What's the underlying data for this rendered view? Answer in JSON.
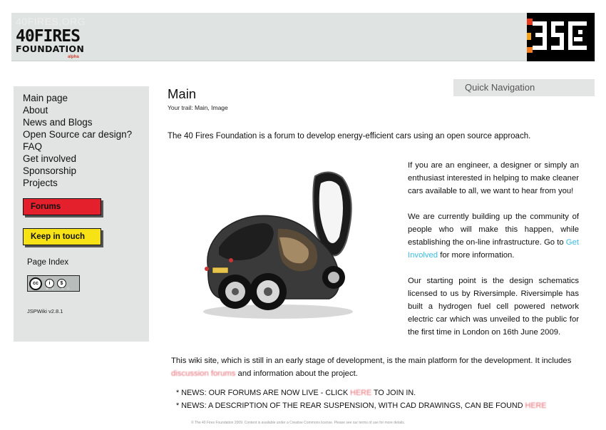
{
  "header": {
    "logo_main": "40FIRES",
    "logo_sub": "FOUNDATION",
    "logo_tag": "alpha",
    "faded_heading": "40FIRES.ORG"
  },
  "sidebar": {
    "items": [
      {
        "label": "Main page"
      },
      {
        "label": "About"
      },
      {
        "label": "News and Blogs"
      },
      {
        "label": "Open Source car design?"
      },
      {
        "label": "FAQ"
      },
      {
        "label": "Get involved"
      },
      {
        "label": "Sponsorship"
      },
      {
        "label": "Projects"
      }
    ],
    "forums_label": "Forums",
    "keep_label": "Keep in touch",
    "page_index": "Page Index",
    "version": "JSPWiki v2.8.1",
    "cc_badge": {
      "cc": "cc",
      "by": "BY",
      "nc": "NC"
    }
  },
  "quicknav": {
    "label": "Quick Navigation"
  },
  "main": {
    "title": "Main",
    "trail_prefix": "Your trail:",
    "trail_main": "Main,",
    "trail_image": "Image",
    "intro": "The 40 Fires Foundation is a forum to develop energy-efficient cars using an open source approach.",
    "p1": "If you are an engineer, a designer or simply an enthusiast interested in helping to make cleaner cars available to all, we want to hear from you!",
    "p2_a": "We are currently building up the community of people who will make this happen, while establishing the on-line infrastructure. Go to ",
    "p2_link": "Get Involved",
    "p2_b": " for more information.",
    "p3": "Our starting point is the design schematics licensed to us by Riversimple. Riversimple has built a hydrogen fuel cell powered network electric car which was unveiled to the public for the first time in London on 16th June 2009.",
    "wiki_a": "This wiki site, which is still in an early stage of development, is the main platform for the development. It includes ",
    "wiki_link": "discussion forums",
    "wiki_b": " and information about the project.",
    "news1_a": "* NEWS: OUR FORUMS ARE NOW LIVE - CLICK ",
    "news1_link": "HERE",
    "news1_b": " TO JOIN IN.",
    "news2_a": "* NEWS: A DESCRIPTION OF THE REAR SUSPENSION, WITH CAD DRAWINGS, CAN BE FOUND ",
    "news2_link": "HERE",
    "footer": "© The 40 Fires Foundation 2009. Content is available under a Creative Commons license. Please see our terms of use for more details."
  },
  "colors": {
    "forums_bg": "#e4202c",
    "keep_bg": "#f7e216",
    "link_blue": "#3bbde0",
    "link_red": "#e46a73",
    "header_bg": "#dfe3e2",
    "sidebar_bg": "#e1e4e3"
  },
  "icons": [
    "40fires-logo",
    "pixel-badge-icon",
    "creative-commons-icon",
    "car-image"
  ]
}
